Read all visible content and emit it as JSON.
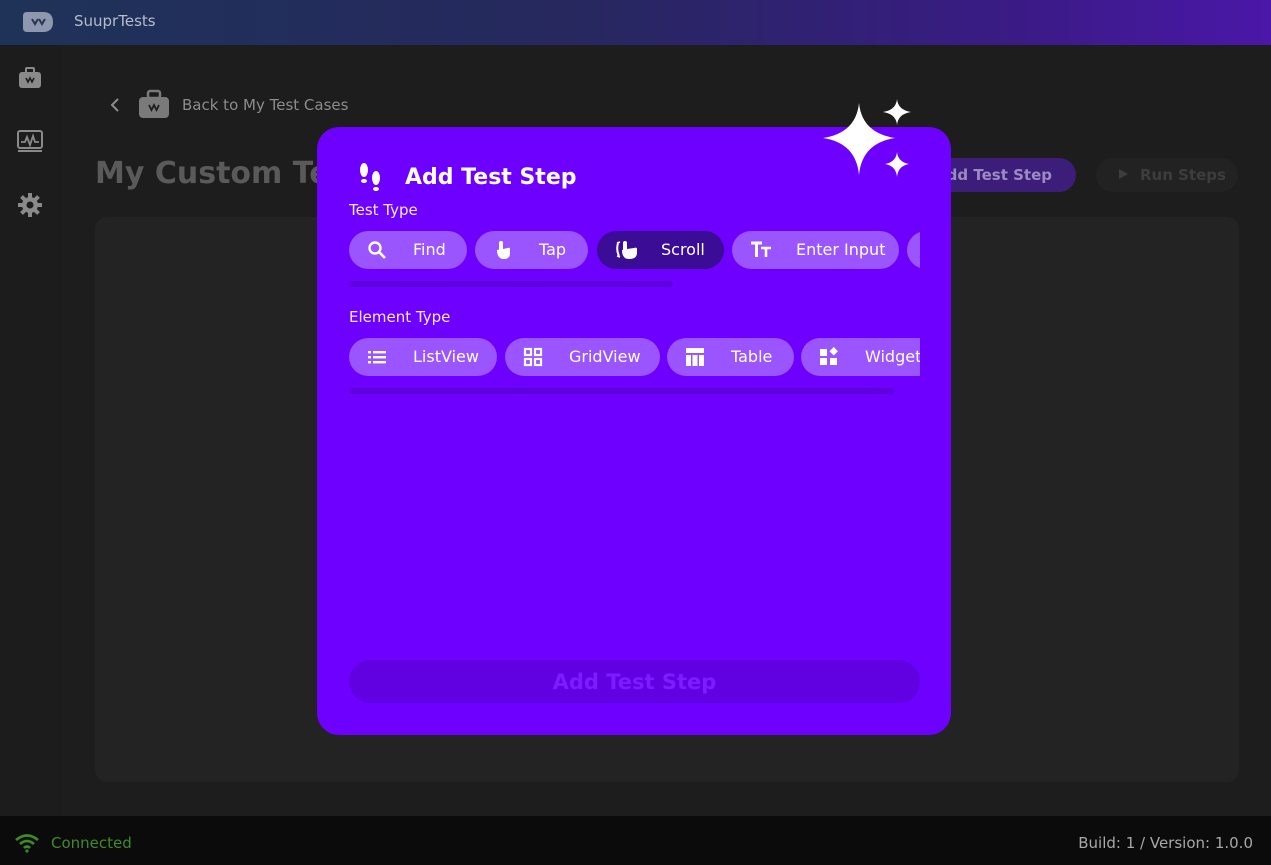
{
  "app": {
    "title": "SuuprTests",
    "accent": "#6e00ff"
  },
  "rail": {
    "items": [
      {
        "icon": "briefcase-icon"
      },
      {
        "icon": "monitor-chart-icon"
      },
      {
        "icon": "gear-icon"
      }
    ]
  },
  "main": {
    "back_label": "Back to My Test Cases",
    "page_title": "My Custom Test",
    "add_step_label": "Add Test Step",
    "run_steps_label": "Run Steps"
  },
  "modal": {
    "title": "Add Test Step",
    "test_type_label": "Test Type",
    "test_types": [
      {
        "label": "Find",
        "icon": "search-icon",
        "selected": false
      },
      {
        "label": "Tap",
        "icon": "tap-hand-icon",
        "selected": false
      },
      {
        "label": "Scroll",
        "icon": "scroll-hand-icon",
        "selected": true
      },
      {
        "label": "Enter Input",
        "icon": "text-input-icon",
        "selected": false
      }
    ],
    "element_type_label": "Element Type",
    "element_types": [
      {
        "label": "ListView",
        "icon": "list-icon"
      },
      {
        "label": "GridView",
        "icon": "grid-icon"
      },
      {
        "label": "Table",
        "icon": "table-icon"
      },
      {
        "label": "Widget",
        "icon": "widgets-icon"
      }
    ],
    "submit_label": "Add Test Step"
  },
  "status": {
    "connection": "Connected",
    "build": "Build: 1 / Version: 1.0.0"
  }
}
